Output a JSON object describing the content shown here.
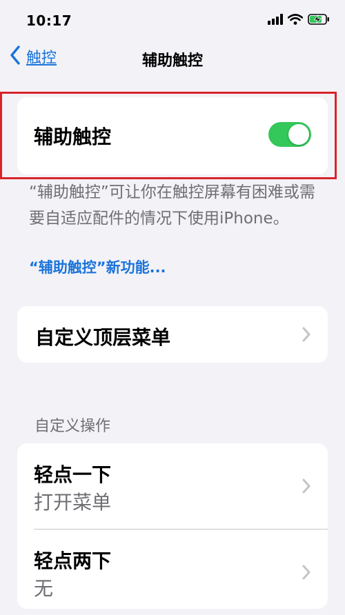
{
  "status_bar": {
    "time": "10:17",
    "icons": [
      "cellular-signal-icon",
      "wifi-icon",
      "battery-charging-icon"
    ]
  },
  "nav": {
    "back_label": "触控",
    "title": "辅助触控"
  },
  "toggle_section": {
    "label": "辅助触控",
    "enabled": true,
    "description": "“辅助触控”可让你在触控屏幕有困难或需要自适应配件的情况下使用iPhone。",
    "link": "“辅助触控”新功能..."
  },
  "menu": {
    "customize_top_level": "自定义顶层菜单"
  },
  "custom_actions": {
    "header": "自定义操作",
    "items": [
      {
        "title": "轻点一下",
        "value": "打开菜单"
      },
      {
        "title": "轻点两下",
        "value": "无"
      }
    ]
  },
  "colors": {
    "accent": "#1a73d9",
    "toggle_on": "#34c759",
    "highlight": "#d9232a",
    "background": "#f2f2f7"
  }
}
